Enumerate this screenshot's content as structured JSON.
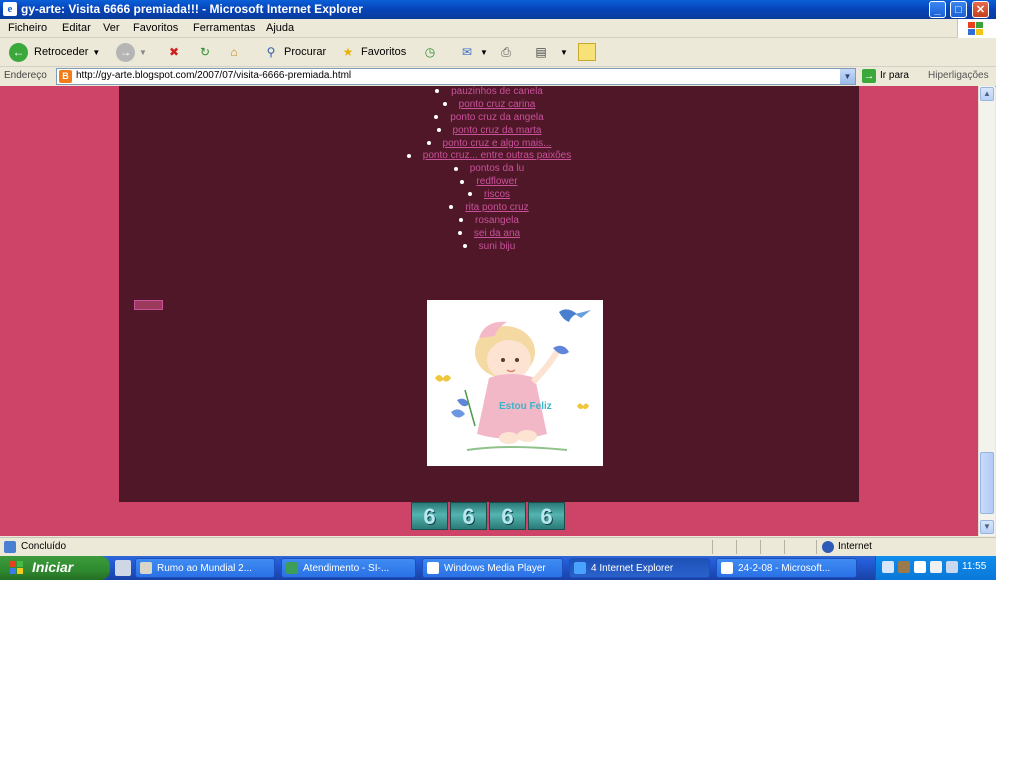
{
  "window": {
    "title": "gy-arte: Visita 6666 premiada!!! - Microsoft Internet Explorer",
    "icon_letter": "e",
    "controls": {
      "minimize": "_",
      "maximize": "□",
      "close": "✕"
    }
  },
  "menu": [
    "Ficheiro",
    "Editar",
    "Ver",
    "Favoritos",
    "Ferramentas",
    "Ajuda"
  ],
  "toolbar": {
    "back_label": "Retroceder",
    "search_label": "Procurar",
    "favorites_label": "Favoritos"
  },
  "address": {
    "label": "Endereço",
    "url": "http://gy-arte.blogspot.com/2007/07/visita-6666-premiada.html",
    "go_label": "Ir para",
    "links_label": "Hiperligações"
  },
  "blog_list": [
    {
      "text": "pauzinhos de canela",
      "linked": false
    },
    {
      "text": "ponto cruz carina",
      "linked": true
    },
    {
      "text": "ponto cruz da angela",
      "linked": false
    },
    {
      "text": "ponto cruz da marta",
      "linked": true
    },
    {
      "text": "ponto cruz e algo mais...",
      "linked": true
    },
    {
      "text": "ponto cruz... entre outras paixões",
      "linked": true
    },
    {
      "text": "pontos da lu",
      "linked": false
    },
    {
      "text": "redflower",
      "linked": true
    },
    {
      "text": "riscos",
      "linked": true
    },
    {
      "text": "rita ponto cruz",
      "linked": true
    },
    {
      "text": "rosangela",
      "linked": false
    },
    {
      "text": "sei da ana",
      "linked": true
    },
    {
      "text": "suni biju",
      "linked": false
    }
  ],
  "picture_caption": "Estou Feliz",
  "visitor_counter": [
    "6",
    "6",
    "6",
    "6"
  ],
  "status": {
    "text": "Concluído",
    "zone": "Internet"
  },
  "taskbar": {
    "start_label": "Iniciar",
    "tasks": [
      {
        "label": "Rumo ao Mundial 2...",
        "active": false,
        "icon_color": "#d9d6c8"
      },
      {
        "label": "Atendimento - SI-...",
        "active": false,
        "icon_color": "#3e9e58"
      },
      {
        "label": "Windows Media Player",
        "active": false,
        "icon_color": "#ffffff"
      },
      {
        "label": "4 Internet Explorer",
        "active": true,
        "icon_color": "#4aa2ff"
      },
      {
        "label": "24-2-08 - Microsoft...",
        "active": false,
        "icon_color": "#ffffff"
      }
    ],
    "clock": "11:55"
  },
  "colors": {
    "page_background": "#ce4469",
    "column_background": "#4f1728",
    "list_text": "#c9529a",
    "counter_digit": "#b8e7f2"
  }
}
